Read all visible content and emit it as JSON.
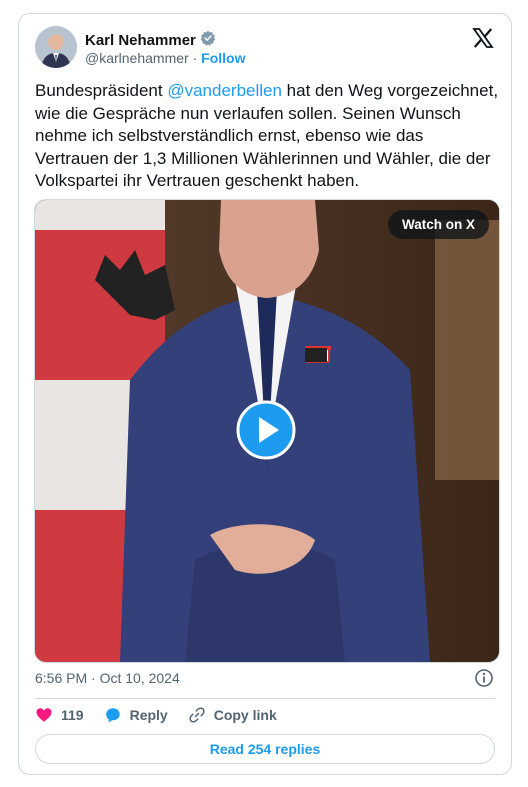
{
  "author": {
    "name": "Karl Nehammer",
    "handle": "@karlnehammer",
    "separator": "·",
    "follow_label": "Follow"
  },
  "tweet": {
    "text_before": "Bundespräsident ",
    "mention": "@vanderbellen",
    "text_after": " hat den Weg vorgezeichnet, wie die Gespräche nun verlaufen sollen. Seinen Wunsch nehme ich selbstverständlich ernst, ebenso wie das Vertrauen der 1,3 Millionen Wählerinnen und Wähler, die der Volkspartei ihr Vertrauen geschenkt haben."
  },
  "media": {
    "watch_label": "Watch on X"
  },
  "meta": {
    "timestamp": "6:56 PM · Oct 10, 2024"
  },
  "actions": {
    "like_count": "119",
    "reply_label": "Reply",
    "copy_label": "Copy link"
  },
  "replies_label": "Read 254 replies",
  "colors": {
    "accent": "#1d9bf0",
    "like": "#f91880",
    "border": "#cfd9de",
    "muted": "#536471"
  }
}
